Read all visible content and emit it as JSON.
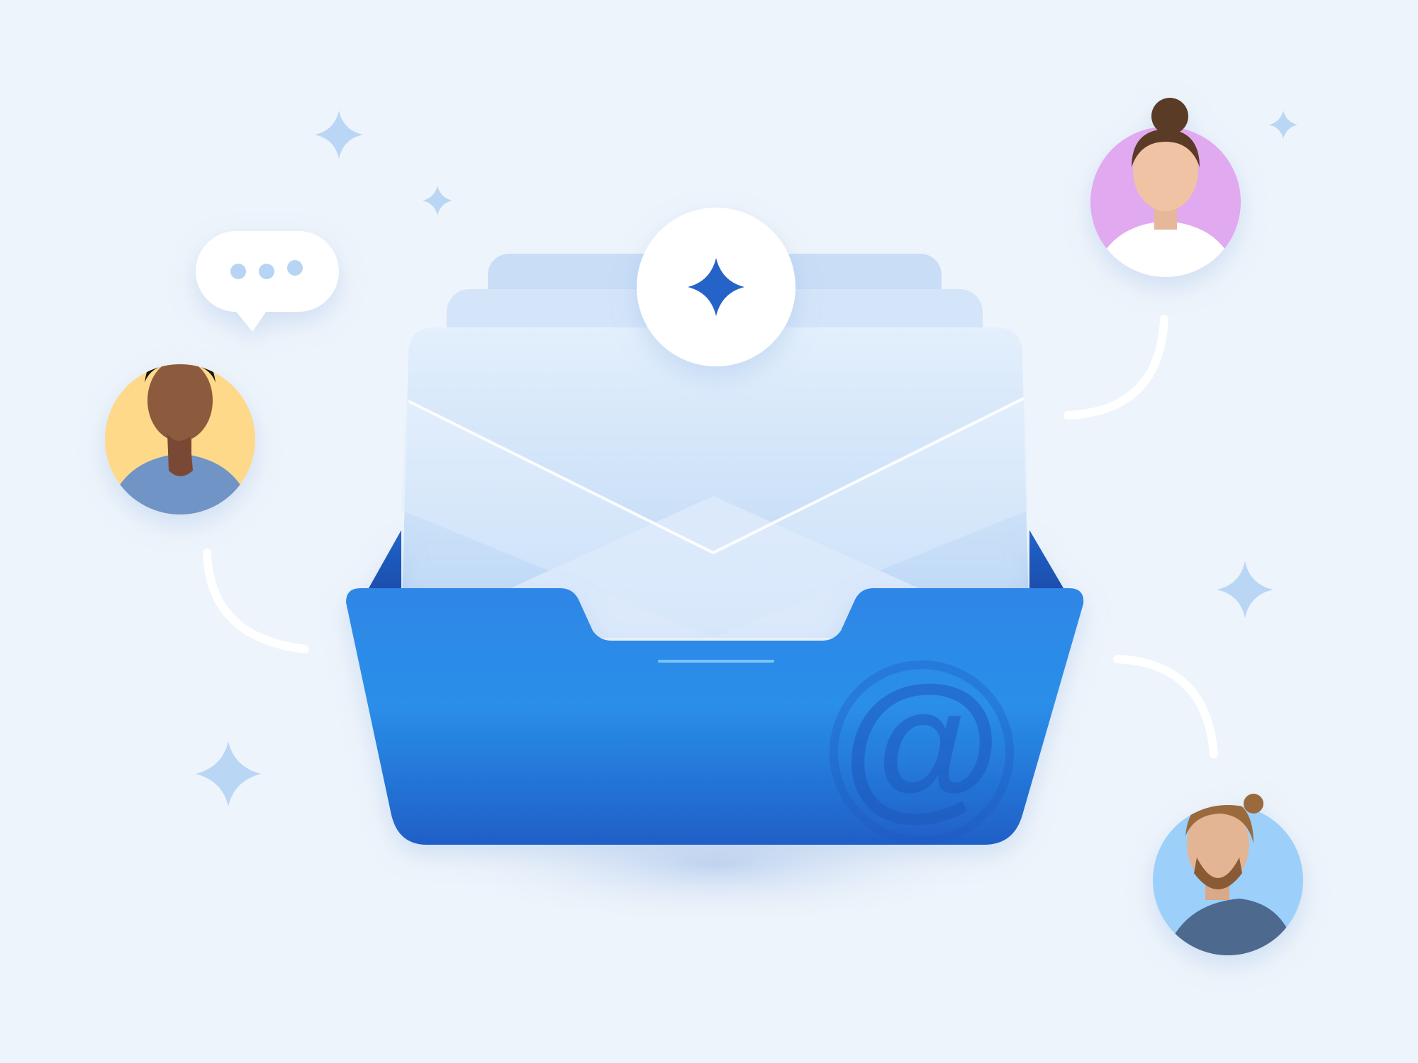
{
  "colors": {
    "background": "#eef4fb",
    "tray_blue": "#2a7be0",
    "tray_blue_dark": "#1f5fc7",
    "sparkle_light": "#b9d6f5",
    "sparkle_dark": "#2563c9",
    "envelope": "#dceafb",
    "connector": "#ffffff",
    "avatar_yellow": "#ffd98a",
    "avatar_pink": "#e1a9f0",
    "avatar_blue": "#9cd0fb"
  },
  "icons": {
    "tray": "inbox-tray-icon",
    "envelope": "envelope-icon",
    "at_sign": "at-sign-icon",
    "sparkle": "sparkle-icon",
    "chat": "chat-bubble-icon"
  },
  "at_symbol": "@",
  "chat_bubble": {
    "dots": 3
  },
  "avatars": [
    {
      "id": "man-thinking",
      "bg": "#ffd98a"
    },
    {
      "id": "woman-smiling",
      "bg": "#e1a9f0"
    },
    {
      "id": "man-bearded",
      "bg": "#9cd0fb"
    }
  ]
}
